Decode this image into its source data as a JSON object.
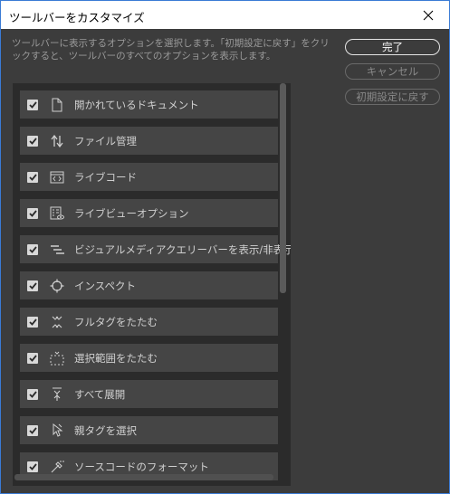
{
  "window": {
    "title": "ツールバーをカスタマイズ"
  },
  "description": "ツールバーに表示するオプションを選択します。「初期設定に戻す」をクリックすると、ツールバーのすべてのオプションを表示します。",
  "buttons": {
    "done": "完了",
    "cancel": "キャンセル",
    "reset": "初期設定に戻す"
  },
  "items": [
    {
      "label": "開かれているドキュメント",
      "icon": "document-icon",
      "checked": true
    },
    {
      "label": "ファイル管理",
      "icon": "file-management-icon",
      "checked": true
    },
    {
      "label": "ライブコード",
      "icon": "live-code-icon",
      "checked": true
    },
    {
      "label": "ライブビューオプション",
      "icon": "live-view-options-icon",
      "checked": true
    },
    {
      "label": "ビジュアルメディアクエリーバーを表示/非表示",
      "icon": "visual-media-query-icon",
      "checked": true
    },
    {
      "label": "インスペクト",
      "icon": "inspect-icon",
      "checked": true
    },
    {
      "label": "フルタグをたたむ",
      "icon": "collapse-full-tag-icon",
      "checked": true
    },
    {
      "label": "選択範囲をたたむ",
      "icon": "collapse-selection-icon",
      "checked": true
    },
    {
      "label": "すべて展開",
      "icon": "expand-all-icon",
      "checked": true
    },
    {
      "label": "親タグを選択",
      "icon": "select-parent-tag-icon",
      "checked": true
    },
    {
      "label": "ソースコードのフォーマット",
      "icon": "format-source-code-icon",
      "checked": true
    }
  ]
}
